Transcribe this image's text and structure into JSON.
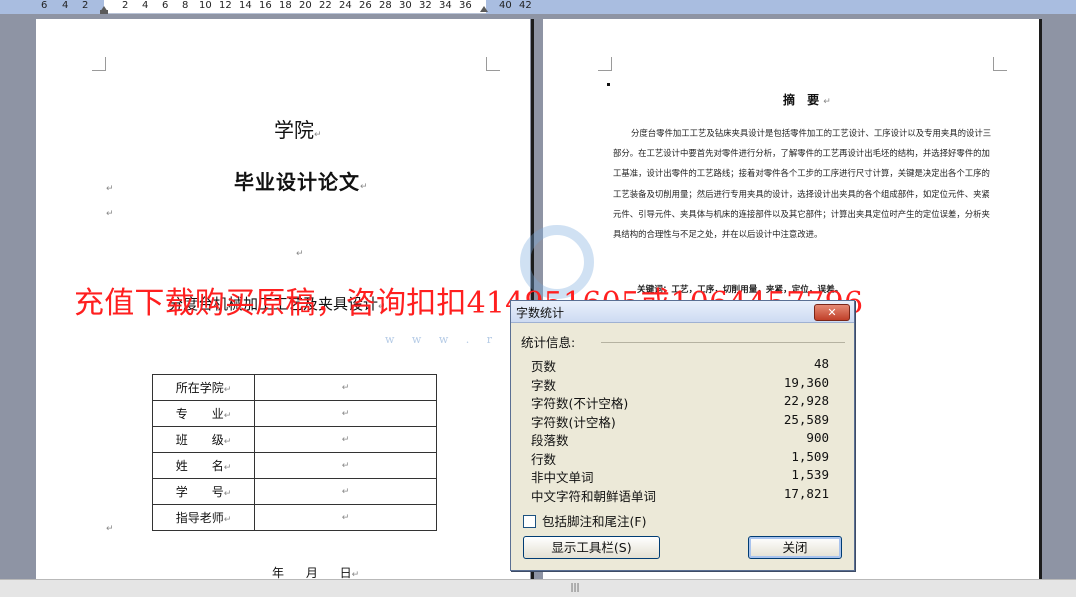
{
  "ruler": {
    "ticks": [
      "6",
      "4",
      "2",
      "2",
      "4",
      "6",
      "8",
      "10",
      "12",
      "14",
      "16",
      "18",
      "20",
      "22",
      "24",
      "26",
      "28",
      "30",
      "32",
      "34",
      "36",
      "40",
      "42"
    ]
  },
  "left_page": {
    "school": "学院",
    "thesis_title": "毕业设计论文",
    "topic": "分度台机械加工工艺及夹具设计",
    "info_rows": [
      {
        "label": "所在学院"
      },
      {
        "label": "专　　业"
      },
      {
        "label": "班　　级"
      },
      {
        "label": "姓　　名"
      },
      {
        "label": "学　　号"
      },
      {
        "label": "指导老师"
      }
    ],
    "date_line": "年 月 日"
  },
  "right_page": {
    "abstract_title": "摘 要",
    "abstract_body": "分度台零件加工工艺及钻床夹具设计是包括零件加工的工艺设计、工序设计以及专用夹具的设计三部分。在工艺设计中要首先对零件进行分析，了解零件的工艺再设计出毛坯的结构，并选择好零件的加工基准，设计出零件的工艺路线；接着对零件各个工步的工序进行尺寸计算，关键是决定出各个工序的工艺装备及切削用量；然后进行专用夹具的设计，选择设计出夹具的各个组成部件，如定位元件、夹紧元件、引导元件、夹具体与机床的连接部件以及其它部件；计算出夹具定位时产生的定位误差，分析夹具结构的合理性与不足之处，并在以后设计中注意改进。",
    "keywords": "关键词：工艺，工序，切削用量，夹紧，定位，误差。"
  },
  "watermark": {
    "promo_text": "充值下载购买原稿，咨询扣扣414951605或1064457796",
    "url_text": "w w w . r e n c · · c . c o m"
  },
  "dialog": {
    "title": "字数统计",
    "close_x": "✕",
    "section_label": "统计信息:",
    "stats": [
      {
        "name": "页数",
        "value": "48"
      },
      {
        "name": "字数",
        "value": "19,360"
      },
      {
        "name": "字符数(不计空格)",
        "value": "22,928"
      },
      {
        "name": "字符数(计空格)",
        "value": "25,589"
      },
      {
        "name": "段落数",
        "value": "900"
      },
      {
        "name": "行数",
        "value": "1,509"
      },
      {
        "name": "非中文单词",
        "value": "1,539"
      },
      {
        "name": "中文字符和朝鲜语单词",
        "value": "17,821"
      }
    ],
    "checkbox_label": "包括脚注和尾注(F)",
    "show_toolbar_button": "显示工具栏(S)",
    "close_button": "关闭"
  },
  "colors": {
    "watermark_red": "#ff1f1f",
    "ruler_blue": "#a9bde0",
    "dialog_bg": "#ece9d8"
  }
}
